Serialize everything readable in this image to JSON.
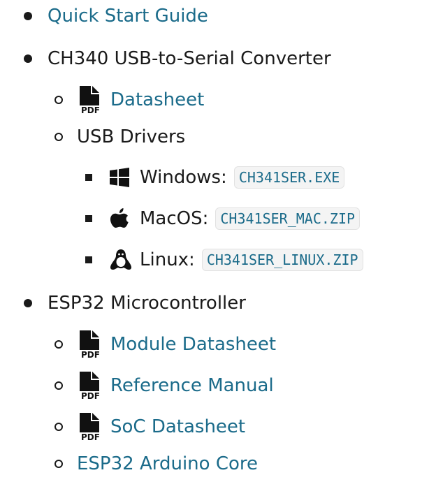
{
  "top_list": [
    {
      "label": "Quick Start Guide"
    },
    {
      "label": "CH340 USB-to-Serial Converter"
    },
    {
      "label": "ESP32 Microcontroller"
    }
  ],
  "ch340": {
    "datasheet_label": "Datasheet",
    "pdf_badge": "PDF",
    "drivers_label": "USB Drivers",
    "drivers": [
      {
        "os_label": "Windows:",
        "file": "CH341SER.EXE",
        "icon": "windows-icon"
      },
      {
        "os_label": "MacOS:",
        "file": "CH341SER_MAC.ZIP",
        "icon": "apple-icon"
      },
      {
        "os_label": "Linux:",
        "file": "CH341SER_LINUX.ZIP",
        "icon": "linux-icon"
      }
    ]
  },
  "esp32": {
    "docs": [
      {
        "label": "Module Datasheet",
        "icon": "pdf-icon"
      },
      {
        "label": "Reference Manual",
        "icon": "pdf-icon"
      },
      {
        "label": "SoC Datasheet",
        "icon": "pdf-icon"
      }
    ],
    "core_label": "ESP32 Arduino Core"
  },
  "colors": {
    "link": "#1b6b8a",
    "text": "#1a1a1a",
    "code_bg": "#f4f4f4"
  }
}
